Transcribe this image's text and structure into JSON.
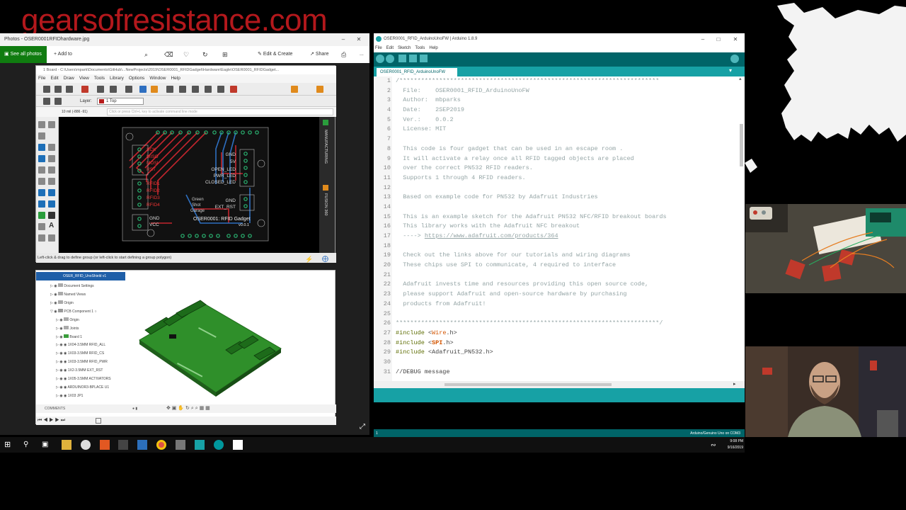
{
  "brand": {
    "text": "gearsofresistance.com"
  },
  "photos": {
    "title": "Photos - OSER0001RFIDhardware.jpg",
    "see_all": "See all photos",
    "add_to": "Add to",
    "edit_create": "Edit & Create",
    "share": "Share",
    "more": "...",
    "eagle": {
      "title": "1 Board - C:\\Users\\mpark\\Documents\\GitHub\\...NewProjects\\2019\\OSER0001_RFIDGadget\\Hardware\\Eagle\\OSER0001_RFIDGadget...",
      "menu": [
        "File",
        "Edit",
        "Draw",
        "View",
        "Tools",
        "Library",
        "Options",
        "Window",
        "Help"
      ],
      "layer_label": "Layer:",
      "layer_value": "1 Top",
      "coord": "10 mil (-886 -91)",
      "cmd_placeholder": "Click or press Ctrl+L key to activate command line mode",
      "status": "Left-click & drag to define group (or left-click to start defining a group polygon)",
      "right_tabs": [
        "MANUFACTURING",
        "FUSION 360"
      ],
      "board": {
        "left_labels": [
          "SCK",
          "MISO",
          "MOSI",
          "RST",
          "RFID1",
          "RFID2",
          "RFID3",
          "RFID4",
          "GND",
          "VCC"
        ],
        "right_labels": [
          "GND",
          "5V",
          "OPEN_LED",
          "PWR_LED",
          "CLOSED_LED",
          "GND",
          "EXT_RST"
        ],
        "center_labels": [
          "Green",
          "Shot",
          "Garage"
        ],
        "title": "OSER0001: RFID Gadget",
        "version": "v0.0.1"
      }
    },
    "fusion": {
      "header": "OSER_RFID_UnoShield v1",
      "tree": [
        "Document Settings",
        "Named Views",
        "Origin",
        "PCB Component 1",
        "Origin",
        "Joints",
        "Board 1",
        "1X04-3.5MM RFID_ALL",
        "1X03-3.5MM RFID_CS",
        "1X03-3.5MM RFID_PWR",
        "1X2-3.5MM EXT_RST",
        "1X05-3.5MM ACTIVATORS",
        "ARDUINOR3-BPLACE U1",
        "1X03 JP1"
      ],
      "comments": "COMMENTS"
    }
  },
  "arduino": {
    "title": "OSER0001_RFID_ArduinoUnoFW | Arduino 1.8.9",
    "menu": [
      "File",
      "Edit",
      "Sketch",
      "Tools",
      "Help"
    ],
    "tab": "OSER0001_RFID_ArduinoUnoFW",
    "line_numbers": [
      "1",
      "2",
      "3",
      "4",
      "5",
      "6",
      "7",
      "8",
      "9",
      "10",
      "11",
      "12",
      "13",
      "14",
      "15",
      "16",
      "17",
      "18",
      "19",
      "20",
      "21",
      "22",
      "23",
      "24",
      "25",
      "26",
      "27",
      "28",
      "29",
      "30",
      "31"
    ],
    "lines": {
      "l1": "/************************************************************************",
      "l2": "  File:    OSER0001_RFID_ArduinoUnoFW",
      "l3": "  Author:  mbparks",
      "l4": "  Date:    2SEP2019",
      "l5": "  Ver.:    0.0.2",
      "l6": "  License: MIT",
      "l7": "",
      "l8": "  This code is four gadget that can be used in an escape room .",
      "l9": "  It will activate a relay once all RFID tagged objects are placed",
      "l10": "  over the correct PN532 RFID readers.",
      "l11": "  Supports 1 through 4 RFID readers.",
      "l12": "",
      "l13": "  Based on example code for PN532 by Adafruit Industries",
      "l14": "",
      "l15": "  This is an example sketch for the Adafruit PN532 NFC/RFID breakout boards",
      "l16": "  This library works with the Adafruit NFC breakout",
      "l17_pre": "  ----> ",
      "l17_link": "https://www.adafruit.com/products/364",
      "l18": "",
      "l19": "  Check out the links above for our tutorials and wiring diagrams",
      "l20": "  These chips use SPI to communicate, 4 required to interface",
      "l21": "",
      "l22": "  Adafruit invests time and resources providing this open source code,",
      "l23": "  please support Adafruit and open-source hardware by purchasing",
      "l24": "  products from Adafruit!",
      "l25": "",
      "l26": "*************************************************************************/",
      "l27_kw": "#include",
      "l27_lib": "Wire",
      "l28_kw": "#include",
      "l28_lib": "SPI",
      "l29_kw": "#include",
      "l29_lib": "Adafruit_PN532.h",
      "l30": "",
      "l31": "//DEBUG message"
    },
    "include_ext": ".h",
    "console_line": "1",
    "board_status": "Arduino/Genuino Uno on COM3"
  },
  "taskbar": {
    "time": "9:08 PM",
    "date": "9/16/2019"
  },
  "colors": {
    "arduino_teal": "#006468",
    "arduino_light": "#17a1a5",
    "photos_green": "#107c10",
    "brand_red": "#b3181c"
  }
}
